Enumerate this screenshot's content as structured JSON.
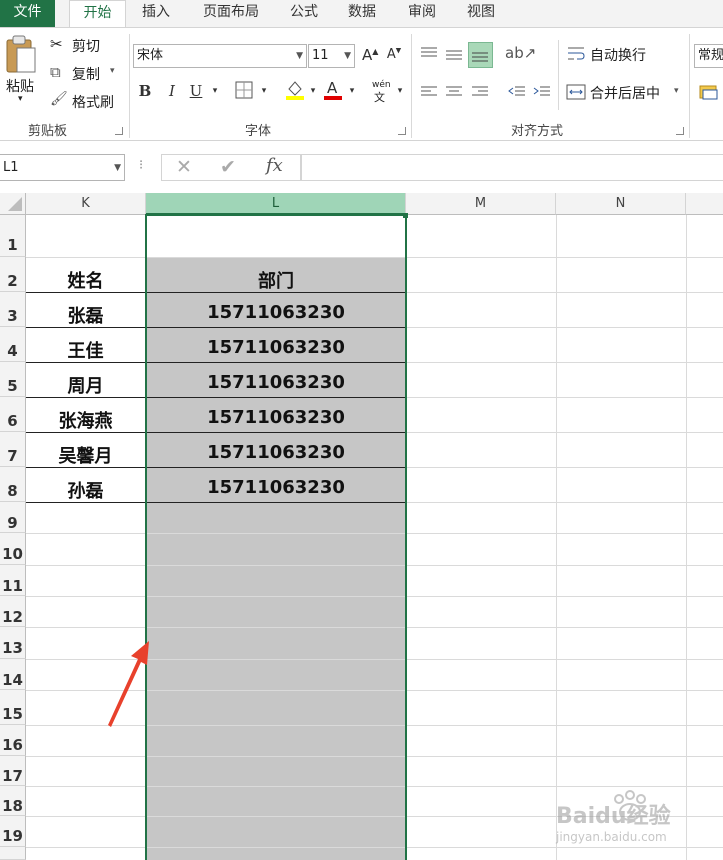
{
  "tabs": {
    "file": "文件",
    "home": "开始",
    "insert": "插入",
    "page_layout": "页面布局",
    "formulas": "公式",
    "data": "数据",
    "review": "审阅",
    "view": "视图"
  },
  "clipboard": {
    "paste": "粘贴",
    "cut": "剪切",
    "copy": "复制",
    "format_painter": "格式刷",
    "group": "剪贴板"
  },
  "font": {
    "name": "宋体",
    "size": "11",
    "bold": "B",
    "italic": "I",
    "underline": "U",
    "phonetic_top": "wén",
    "phonetic_bottom": "文",
    "group": "字体"
  },
  "alignment": {
    "wrap": "自动换行",
    "merge": "合并后居中",
    "group": "对齐方式"
  },
  "number": {
    "format": "常规"
  },
  "formula_bar": {
    "name_box": "L1",
    "fx": "fx",
    "value": ""
  },
  "columns": [
    "K",
    "L",
    "M",
    "N"
  ],
  "rows": [
    "1",
    "2",
    "3",
    "4",
    "5",
    "6",
    "7",
    "8",
    "9",
    "10",
    "11",
    "12",
    "13",
    "14",
    "15",
    "16",
    "17",
    "18",
    "19"
  ],
  "table": {
    "header": {
      "name": "姓名",
      "dept": "部门"
    },
    "records": [
      {
        "name": "张磊",
        "dept": "15711063230"
      },
      {
        "name": "王佳",
        "dept": "15711063230"
      },
      {
        "name": "周月",
        "dept": "15711063230"
      },
      {
        "name": "张海燕",
        "dept": "15711063230"
      },
      {
        "name": "吴馨月",
        "dept": "15711063230"
      },
      {
        "name": "孙磊",
        "dept": "15711063230"
      }
    ]
  },
  "colors": {
    "accent": "#217346",
    "selection_fill": "#c6c6c6",
    "selected_header": "#9fd5b7",
    "arrow": "#e8412c"
  },
  "watermark": {
    "brand": "Baidu经验",
    "url": "jingyan.baidu.com"
  }
}
